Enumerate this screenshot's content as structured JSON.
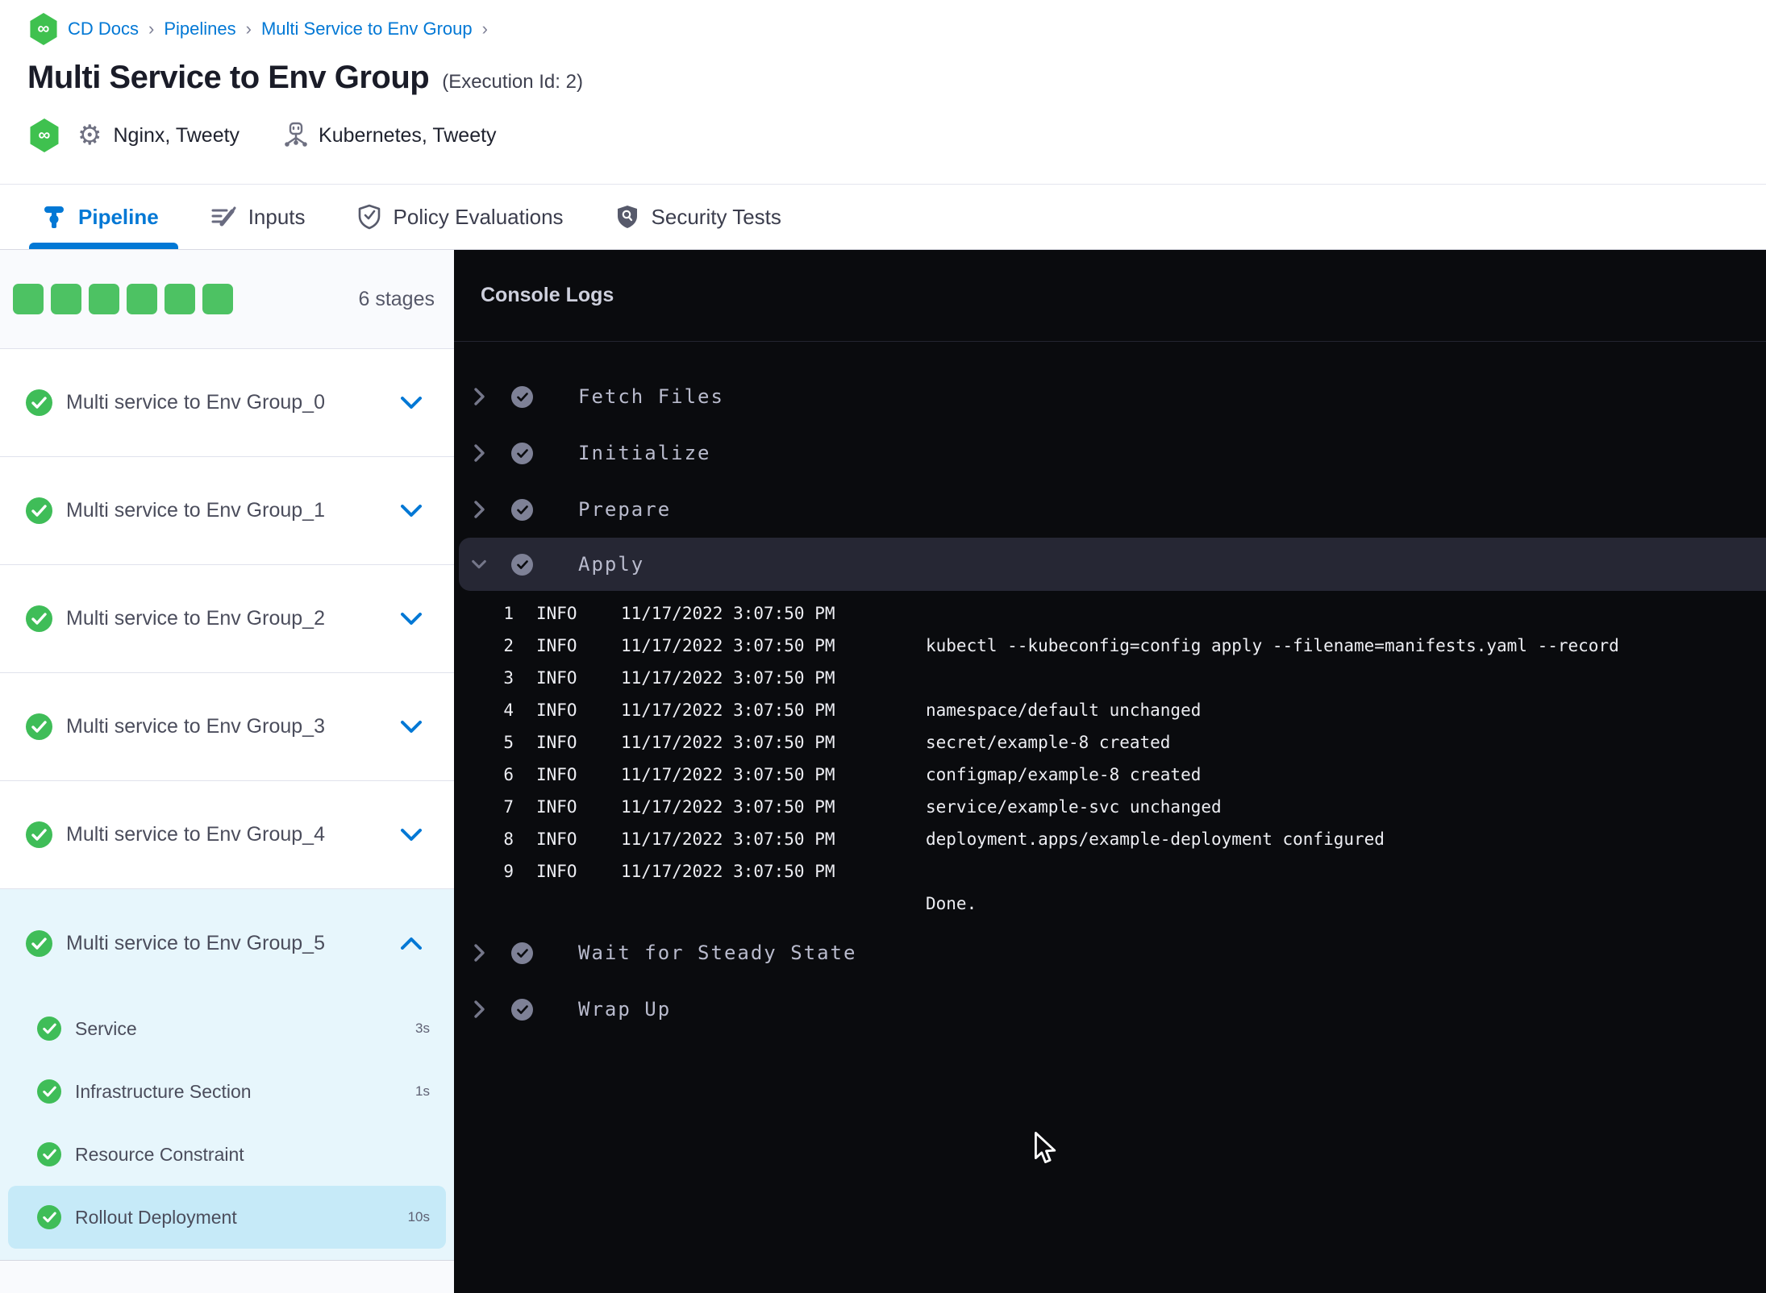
{
  "breadcrumb": {
    "separator": "›",
    "items": [
      "CD Docs",
      "Pipelines",
      "Multi Service to Env Group"
    ]
  },
  "header": {
    "title": "Multi Service to Env Group",
    "execution_id": "(Execution Id: 2)",
    "services_label": "Nginx, Tweety",
    "infrastructure_label": "Kubernetes, Tweety"
  },
  "tabs": [
    {
      "label": "Pipeline",
      "active": true
    },
    {
      "label": "Inputs",
      "active": false
    },
    {
      "label": "Policy Evaluations",
      "active": false
    },
    {
      "label": "Security Tests",
      "active": false
    }
  ],
  "sidebar": {
    "stages_count_label": "6 stages",
    "stages": [
      {
        "name": "Multi service to Env Group_0",
        "status": "success",
        "expanded": false
      },
      {
        "name": "Multi service to Env Group_1",
        "status": "success",
        "expanded": false
      },
      {
        "name": "Multi service to Env Group_2",
        "status": "success",
        "expanded": false
      },
      {
        "name": "Multi service to Env Group_3",
        "status": "success",
        "expanded": false
      },
      {
        "name": "Multi service to Env Group_4",
        "status": "success",
        "expanded": false
      },
      {
        "name": "Multi service to Env Group_5",
        "status": "success",
        "expanded": true
      }
    ],
    "substeps": [
      {
        "label": "Service",
        "duration": "3s",
        "selected": false
      },
      {
        "label": "Infrastructure Section",
        "duration": "1s",
        "selected": false
      },
      {
        "label": "Resource Constraint",
        "duration": "",
        "selected": false
      },
      {
        "label": "Rollout Deployment",
        "duration": "10s",
        "selected": true
      }
    ]
  },
  "console": {
    "title": "Console Logs",
    "steps_before": [
      "Fetch Files",
      "Initialize",
      "Prepare"
    ],
    "expanded_step": "Apply",
    "steps_after": [
      "Wait for Steady State",
      "Wrap Up"
    ],
    "logs": [
      {
        "num": "1",
        "level": "INFO",
        "ts": "11/17/2022 3:07:50 PM",
        "msg": ""
      },
      {
        "num": "2",
        "level": "INFO",
        "ts": "11/17/2022 3:07:50 PM",
        "msg": "kubectl --kubeconfig=config apply --filename=manifests.yaml --record"
      },
      {
        "num": "3",
        "level": "INFO",
        "ts": "11/17/2022 3:07:50 PM",
        "msg": ""
      },
      {
        "num": "4",
        "level": "INFO",
        "ts": "11/17/2022 3:07:50 PM",
        "msg": "namespace/default unchanged"
      },
      {
        "num": "5",
        "level": "INFO",
        "ts": "11/17/2022 3:07:50 PM",
        "msg": "secret/example-8 created"
      },
      {
        "num": "6",
        "level": "INFO",
        "ts": "11/17/2022 3:07:50 PM",
        "msg": "configmap/example-8 created"
      },
      {
        "num": "7",
        "level": "INFO",
        "ts": "11/17/2022 3:07:50 PM",
        "msg": "service/example-svc unchanged"
      },
      {
        "num": "8",
        "level": "INFO",
        "ts": "11/17/2022 3:07:50 PM",
        "msg": "deployment.apps/example-deployment configured"
      },
      {
        "num": "9",
        "level": "INFO",
        "ts": "11/17/2022 3:07:50 PM",
        "msg": ""
      }
    ],
    "done_line": "Done."
  },
  "colors": {
    "accent_blue": "#0278d5",
    "success_green": "#4dc263",
    "console_bg": "#0a0b0e",
    "console_row_highlight": "#262734",
    "selected_substep_bg": "#c6eaf8",
    "expanded_section_bg": "#e7f6fc"
  }
}
